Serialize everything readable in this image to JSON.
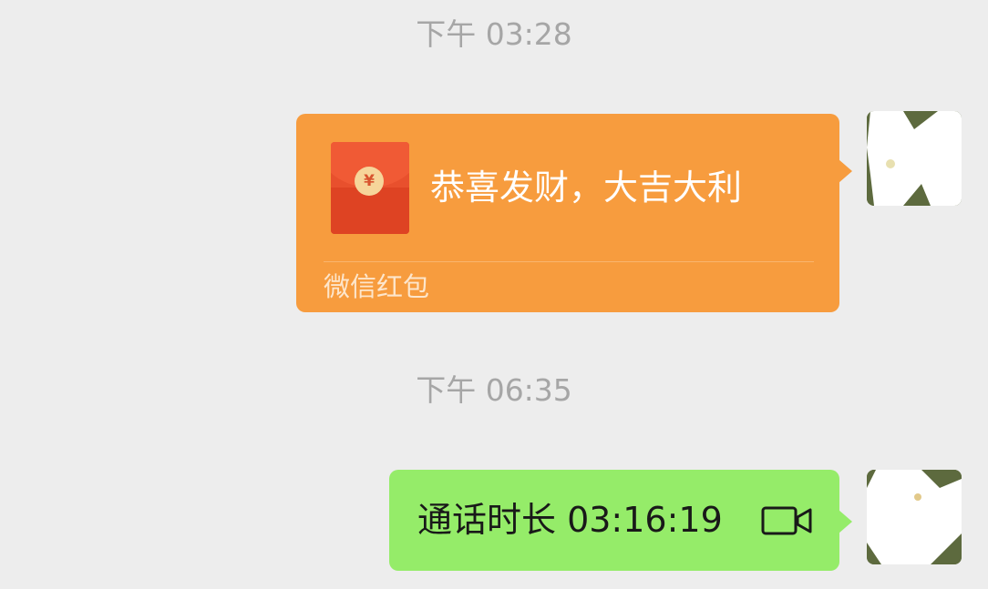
{
  "chat": {
    "timestamps": [
      "下午 03:28",
      "下午 06:35"
    ],
    "red_packet": {
      "greeting": "恭喜发财，大吉大利",
      "label": "微信红包",
      "coin_symbol": "¥",
      "bubble_color": "#f79c3e",
      "envelope_color": "#e8502d"
    },
    "call_record": {
      "text": "通话时长 03:16:19",
      "icon": "video-camera-icon",
      "bubble_color": "#95ec69"
    }
  },
  "avatars": [
    {
      "icon": "avatar-redacted"
    },
    {
      "icon": "avatar-redacted"
    }
  ],
  "colors": {
    "background": "#ededed",
    "timestamp_text": "#a6a6a6"
  }
}
